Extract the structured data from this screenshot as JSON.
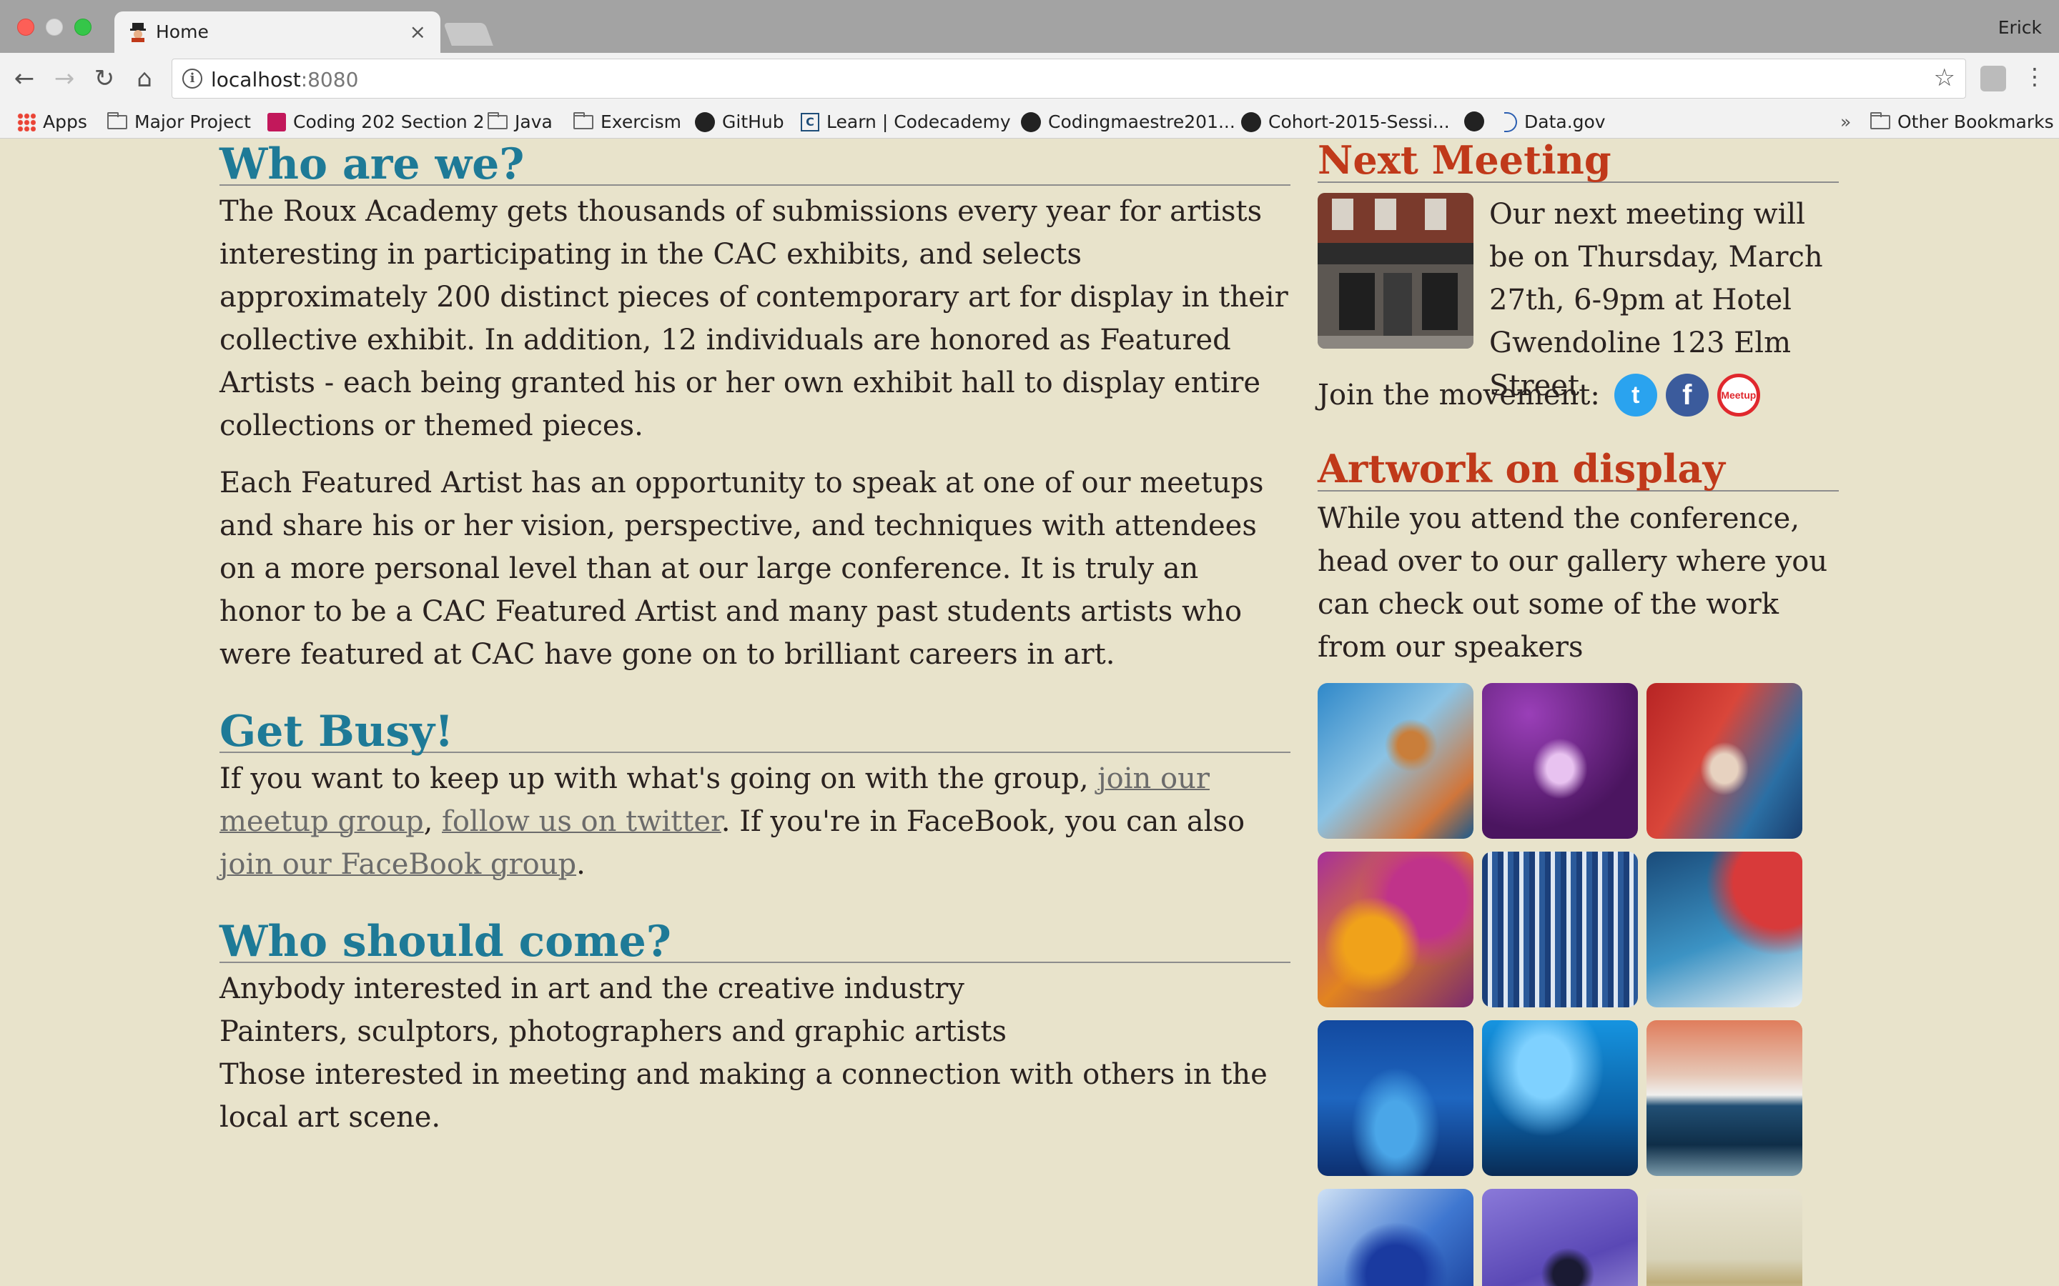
{
  "browser": {
    "tab_title": "Home",
    "profile_name": "Erick",
    "url_host": "localhost",
    "url_port": ":8080",
    "bookmarks": [
      {
        "label": "Apps",
        "icon": "apps-grid-icon"
      },
      {
        "label": "Major Project",
        "icon": "folder-icon"
      },
      {
        "label": "Coding 202 Section 2",
        "icon": "codecademy-icon"
      },
      {
        "label": "Java",
        "icon": "folder-icon"
      },
      {
        "label": "Exercism",
        "icon": "folder-icon"
      },
      {
        "label": "GitHub",
        "icon": "github-icon"
      },
      {
        "label": "Learn | Codecademy",
        "icon": "codecademy-icon"
      },
      {
        "label": "Codingmaestre201...",
        "icon": "github-icon"
      },
      {
        "label": "Cohort-2015-Sessi...",
        "icon": "github-icon"
      },
      {
        "label": "",
        "icon": "github-icon"
      },
      {
        "label": "Data.gov",
        "icon": "datagov-icon"
      }
    ],
    "other_bookmarks": "Other Bookmarks",
    "overflow_chevron": "»"
  },
  "main": {
    "who_heading": "Who are we?",
    "who_p1": "The Roux Academy gets thousands of submissions every year for artists interesting in participating in the CAC exhibits, and selects approximately 200 distinct pieces of contemporary art for display in their collective exhibit. In addition, 12 individuals are honored as Featured Artists - each being granted his or her own exhibit hall to display entire collections or themed pieces.",
    "who_p2": "Each Featured Artist has an opportunity to speak at one of our meetups and share his or her vision, perspective, and techniques with attendees on a more personal level than at our large conference. It is truly an honor to be a CAC Featured Artist and many past students artists who were featured at CAC have gone on to brilliant careers in art.",
    "busy_heading": "Get Busy!",
    "busy_text_1": "If you want to keep up with what's going on with the group, ",
    "busy_link_1": "join our meetup group",
    "busy_text_2": ", ",
    "busy_link_2": "follow us on twitter",
    "busy_text_3": ". If you're in FaceBook, you can also ",
    "busy_link_3": "join our FaceBook group",
    "busy_text_4": ".",
    "who_come_heading": "Who should come?",
    "who_come_lines": [
      "Anybody interested in art and the creative industry",
      "Painters, sculptors, photographers and graphic artists",
      "Those interested in meeting and making a connection with others in the local art scene."
    ]
  },
  "aside": {
    "next_heading": "Next Meeting",
    "next_text": "Our next meeting will be on Thursday, March 27th, 6-9pm at Hotel Gwendoline 123 Elm Street",
    "join_label": "Join the movement:",
    "meetup_badge": "Meetup",
    "artwork_heading": "Artwork on display",
    "artwork_text": "While you attend the conference, head over to our gallery where you can check out some of the work from our speakers"
  },
  "colors": {
    "page_bg": "#e8e3cb",
    "main_heading": "#1e7a97",
    "side_heading": "#c0391a",
    "body_text": "#2a2220",
    "link": "#6b6b6b"
  }
}
